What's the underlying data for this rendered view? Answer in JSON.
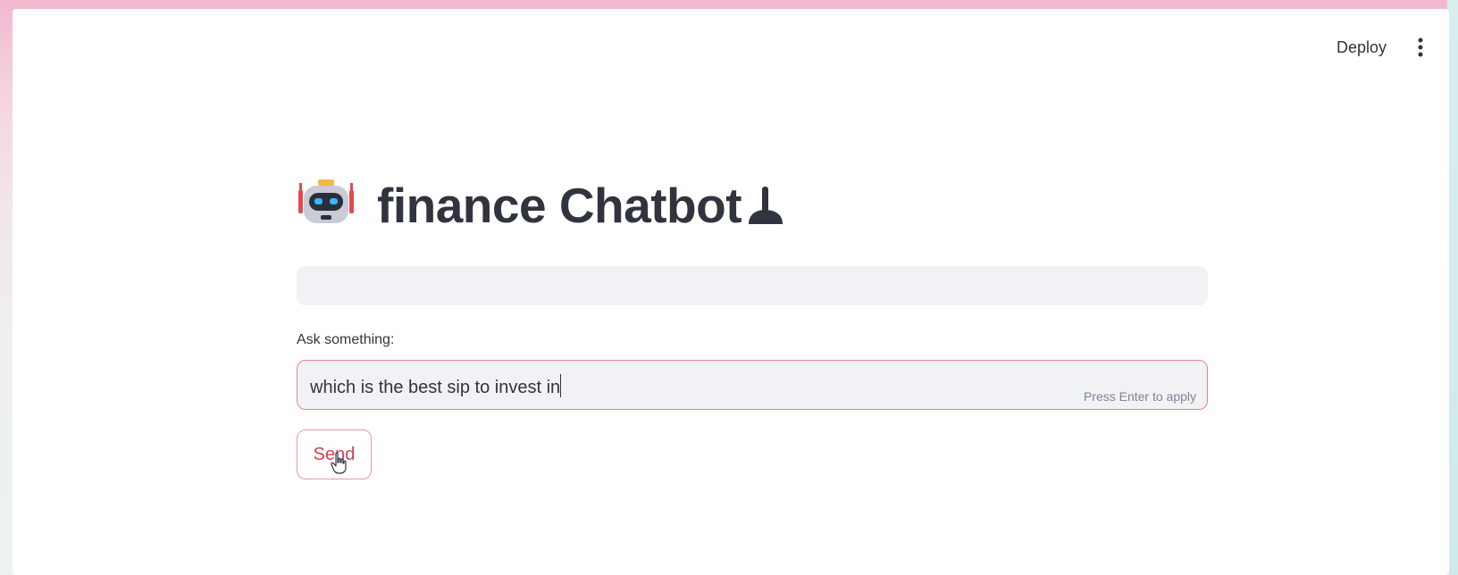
{
  "header": {
    "deploy_label": "Deploy",
    "menu_icon": "vertical-ellipsis-icon"
  },
  "main": {
    "title_icon": "robot-icon",
    "title": "finance Chatbot",
    "title_trailing_icon": "plunger-icon",
    "input_label": "Ask something:",
    "input_value": "which is the best sip to invest in",
    "input_hint": "Press Enter to apply",
    "send_label": "Send"
  },
  "colors": {
    "text": "#31333f",
    "accent": "#ff4b4b",
    "input_bg": "#f0f2f6"
  }
}
